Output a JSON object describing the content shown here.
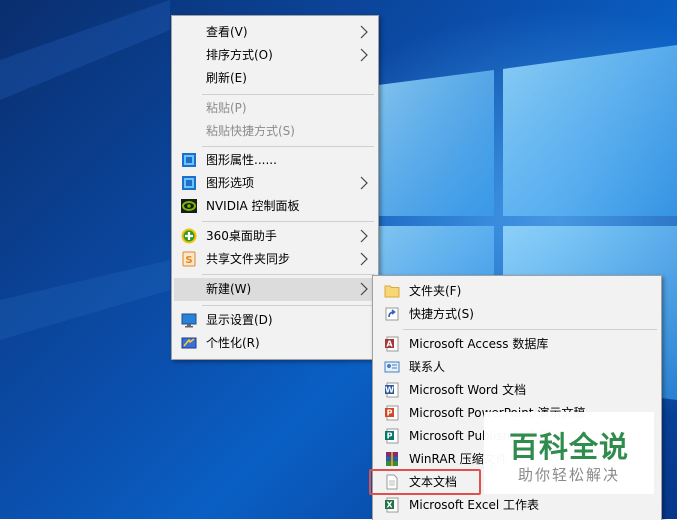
{
  "context_menu": {
    "items": [
      {
        "label": "查看(V)",
        "icon": "none",
        "submenu": true,
        "disabled": false
      },
      {
        "label": "排序方式(O)",
        "icon": "none",
        "submenu": true,
        "disabled": false
      },
      {
        "label": "刷新(E)",
        "icon": "none",
        "submenu": false,
        "disabled": false
      },
      {
        "label": "粘贴(P)",
        "icon": "none",
        "submenu": false,
        "disabled": true
      },
      {
        "label": "粘贴快捷方式(S)",
        "icon": "none",
        "submenu": false,
        "disabled": true
      },
      {
        "label": "图形属性......",
        "icon": "intel-graphics-icon",
        "submenu": false,
        "disabled": false
      },
      {
        "label": "图形选项",
        "icon": "intel-graphics-icon",
        "submenu": true,
        "disabled": false
      },
      {
        "label": "NVIDIA 控制面板",
        "icon": "nvidia-icon",
        "submenu": false,
        "disabled": false
      },
      {
        "label": "360桌面助手",
        "icon": "360-icon",
        "submenu": true,
        "disabled": false
      },
      {
        "label": "共享文件夹同步",
        "icon": "sync-s-icon",
        "submenu": true,
        "disabled": false
      },
      {
        "label": "新建(W)",
        "icon": "none",
        "submenu": true,
        "disabled": false,
        "highlighted": true
      },
      {
        "label": "显示设置(D)",
        "icon": "display-icon",
        "submenu": false,
        "disabled": false
      },
      {
        "label": "个性化(R)",
        "icon": "personalize-icon",
        "submenu": false,
        "disabled": false
      }
    ]
  },
  "new_submenu": {
    "items": [
      {
        "label": "文件夹(F)",
        "icon": "folder-icon"
      },
      {
        "label": "快捷方式(S)",
        "icon": "shortcut-icon"
      },
      {
        "label": "Microsoft Access 数据库",
        "icon": "access-icon"
      },
      {
        "label": "联系人",
        "icon": "contact-icon"
      },
      {
        "label": "Microsoft Word 文档",
        "icon": "word-icon"
      },
      {
        "label": "Microsoft PowerPoint 演示文稿",
        "icon": "powerpoint-icon"
      },
      {
        "label": "Microsoft Publisher 文档",
        "icon": "publisher-icon"
      },
      {
        "label": "WinRAR 压缩文件",
        "icon": "winrar-icon"
      },
      {
        "label": "文本文档",
        "icon": "text-document-icon"
      },
      {
        "label": "Microsoft Excel 工作表",
        "icon": "excel-icon"
      }
    ]
  },
  "watermark": {
    "title": "百科全说",
    "subtitle": "助你轻松解决"
  },
  "colors": {
    "highlight_box": "#e0504d",
    "watermark_green": "#2f8c4c"
  }
}
